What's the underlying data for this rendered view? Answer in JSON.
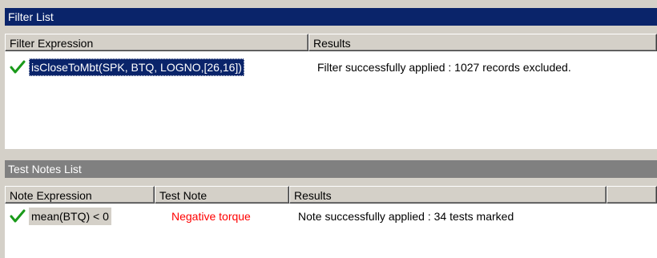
{
  "filter_panel": {
    "title": "Filter List",
    "columns": [
      "Filter Expression",
      "Results"
    ],
    "rows": [
      {
        "status_icon": "green-checkmark-icon",
        "expression": "isCloseToMbt(SPK, BTQ, LOGNO,[26,16])",
        "result": "Filter successfully applied : 1027 records excluded."
      }
    ]
  },
  "notes_panel": {
    "title": "Test Notes List",
    "columns": [
      "Note Expression",
      "Test Note",
      "Results",
      ""
    ],
    "rows": [
      {
        "status_icon": "green-checkmark-icon",
        "expression": "mean(BTQ) < 0",
        "note": "Negative torque",
        "result": "Note successfully applied : 34 tests marked"
      }
    ]
  },
  "colors": {
    "active_title": "#0a246a",
    "inactive_title": "#808080",
    "check": "#1a9a1a",
    "note_text": "#ff0000"
  }
}
